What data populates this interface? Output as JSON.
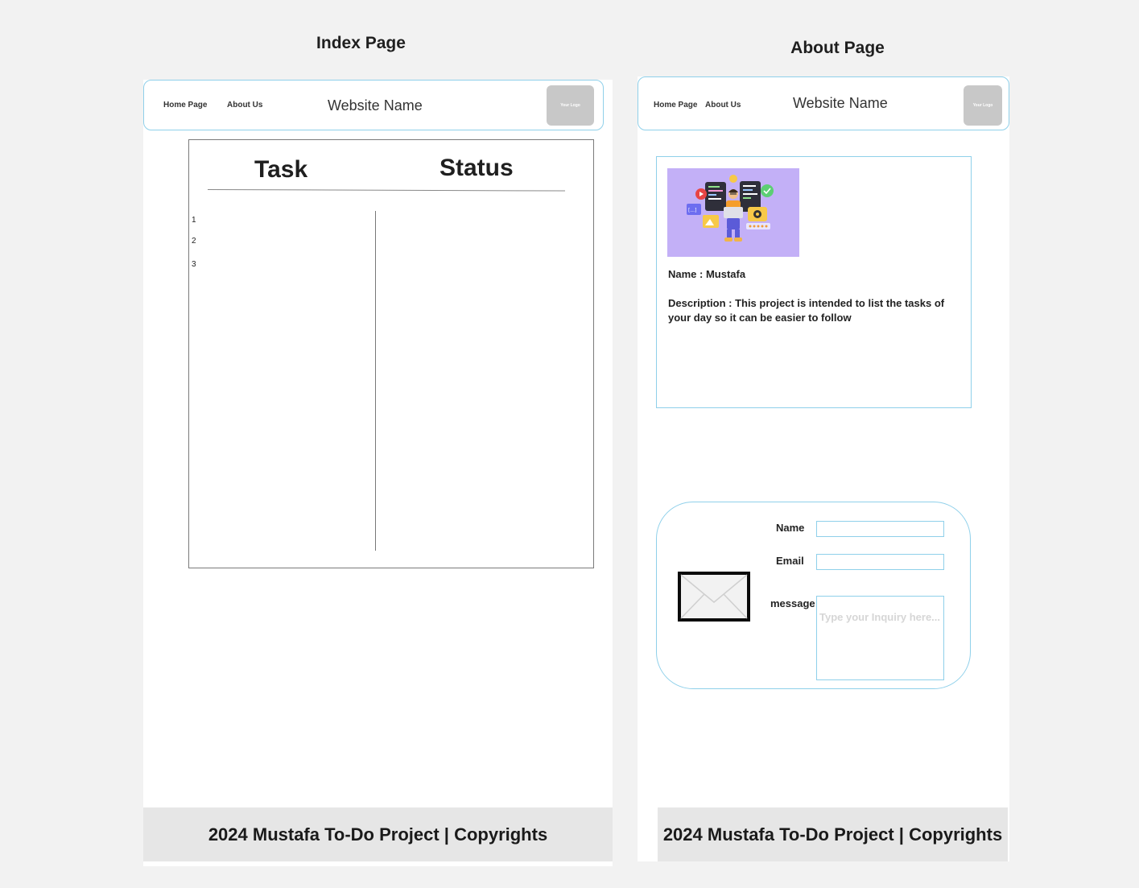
{
  "index_page": {
    "title": "Index Page",
    "nav": {
      "home_label": "Home Page",
      "about_label": "About Us",
      "site_name": "Website Name",
      "logo_text": "Your Logo"
    },
    "table": {
      "columns": [
        "Task",
        "Status"
      ],
      "row_numbers": [
        "1",
        "2",
        "3"
      ]
    },
    "footer": "2024 Mustafa To-Do Project  | Copyrights"
  },
  "about_page": {
    "title": "About Page",
    "nav": {
      "home_label": "Home Page",
      "about_label": "About Us",
      "site_name": "Website Name",
      "logo_text": "Your Logo"
    },
    "profile": {
      "name_line": "Name : Mustafa",
      "description_line": "Description : This project is intended to list the tasks of your day so it can be easier to follow"
    },
    "contact": {
      "name_label": "Name",
      "email_label": "Email",
      "message_label": "message",
      "name_value": "",
      "email_value": "",
      "message_placeholder": "Type your Inquiry here..."
    },
    "footer": "2024 Mustafa To-Do Project  | Copyrights"
  },
  "colors": {
    "accent_border": "#8fd0ea",
    "illustration_bg": "#c3b0f7",
    "footer_bg": "#e6e6e6",
    "canvas_bg": "#f2f2f2"
  },
  "icons": {
    "hero_illustration": "developer-illustration",
    "contact_icon": "envelope-icon"
  }
}
